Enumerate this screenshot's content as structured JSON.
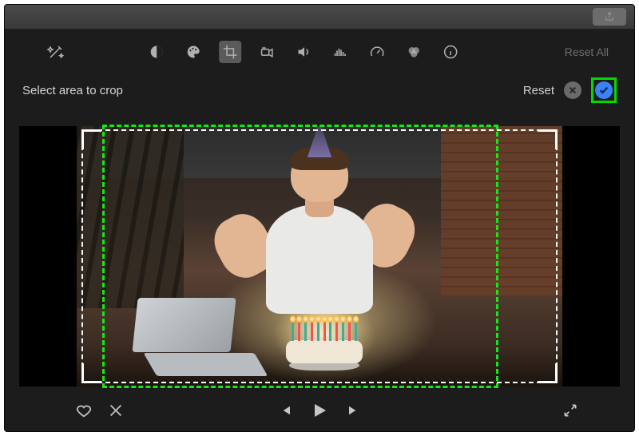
{
  "toolbar": {
    "reset_all_label": "Reset All"
  },
  "crop": {
    "prompt": "Select area to crop",
    "reset_label": "Reset"
  },
  "icons": {
    "share": "share-icon",
    "auto_enhance": "magic-wand-icon",
    "color_balance": "contrast-icon",
    "color_correction": "palette-icon",
    "crop": "crop-icon",
    "stabilization": "camera-icon",
    "volume": "speaker-icon",
    "noise": "equalizer-icon",
    "speed": "speedometer-icon",
    "filter": "overlap-circles-icon",
    "info": "info-icon",
    "cancel": "x-icon",
    "apply": "checkmark-icon",
    "favorite": "heart-icon",
    "reject": "x-icon",
    "prev": "skip-back-icon",
    "play": "play-icon",
    "next": "skip-forward-icon",
    "fullscreen": "expand-icon"
  }
}
